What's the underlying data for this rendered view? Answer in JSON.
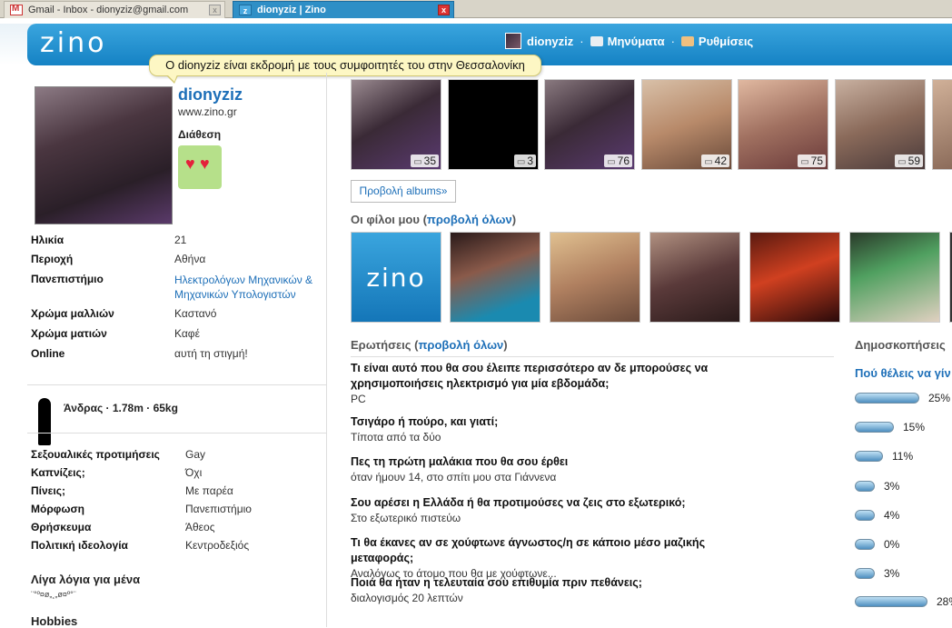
{
  "browser": {
    "tabs": [
      {
        "label": "Gmail - Inbox - dionyziz@gmail.com",
        "active": false,
        "icon": "gmail-icon"
      },
      {
        "label": "dionyziz | Zino",
        "active": true,
        "icon": "zino-icon"
      }
    ]
  },
  "header": {
    "logo": "zino",
    "user": "dionyziz",
    "messages": "Μηνύματα",
    "settings": "Ρυθμίσεις",
    "separator": "·"
  },
  "tooltip": "Ο dionyziz είναι εκδρομή με τους συμφοιτητές του στην Θεσσαλονίκη",
  "profile": {
    "name": "dionyziz",
    "site": "www.zino.gr",
    "mood_label": "Διάθεση",
    "details": [
      {
        "key": "Ηλικία",
        "value": "21"
      },
      {
        "key": "Περιοχή",
        "value": "Αθήνα"
      },
      {
        "key": "Πανεπιστήμιο",
        "value": "Ηλεκτρολόγων Μηχανικών & Μηχανικών Υπολογιστών"
      },
      {
        "key": "Χρώμα μαλλιών",
        "value": "Καστανό"
      },
      {
        "key": "Χρώμα ματιών",
        "value": "Καφέ"
      },
      {
        "key": "Online",
        "value": "αυτή τη στιγμή!"
      }
    ],
    "body": "Άνδρας · 1.78m · 65kg",
    "prefs": [
      {
        "key": "Σεξουαλικές προτιμήσεις",
        "value": "Gay"
      },
      {
        "key": "Καπνίζεις;",
        "value": "Όχι"
      },
      {
        "key": "Πίνεις;",
        "value": "Με παρέα"
      },
      {
        "key": "Μόρφωση",
        "value": "Πανεπιστήμιο"
      },
      {
        "key": "Θρήσκευμα",
        "value": "Άθεος"
      },
      {
        "key": "Πολιτική ιδεολογία",
        "value": "Κεντροδεξιός"
      }
    ],
    "about_label": "Λίγα λόγια για μένα",
    "about_value": "¨°º¤ø„¸„ø¤º°¨",
    "hobbies_label": "Hobbies"
  },
  "photos": {
    "counts": [
      "35",
      "3",
      "76",
      "42",
      "75",
      "59"
    ],
    "albums_button": "Προβολή albums»"
  },
  "friends": {
    "title": "Οι φίλοι μου",
    "view_all": "προβολή όλων",
    "zino_label": "zino"
  },
  "questions": {
    "title": "Ερωτήσεις",
    "view_all": "προβολή όλων",
    "items": [
      {
        "q": "Τι είναι αυτό που θα σου έλειπε περισσότερο αν δε μπορούσες να χρησιμοποιήσεις ηλεκτρισμό για μία εβδομάδα;",
        "a": "PC"
      },
      {
        "q": "Τσιγάρο ή πούρο, και γιατί;",
        "a": "Τίποτα από τα δύο"
      },
      {
        "q": "Πες τη πρώτη μαλάκια που θα σου έρθει",
        "a": "όταν ήμουν 14, στο σπίτι μου στα Γιάννενα"
      },
      {
        "q": "Σου αρέσει η Ελλάδα ή θα προτιμούσες να ζεις στο εξωτερικό;",
        "a": "Στο εξωτερικό πιστεύω"
      },
      {
        "q": "Τι θα έκανες αν σε χούφτωνε άγνωστος/η σε κάποιο μέσο μαζικής μεταφοράς;",
        "a": "Αναλόγως το άτομο που θα με χούφτωνε..."
      },
      {
        "q": "Ποιά θα ήταν η τελευταία σου επιθυμία πριν πεθάνεις;",
        "a": "διαλογισμός 20 λεπτών"
      }
    ]
  },
  "poll": {
    "title": "Δημοσκοπήσεις",
    "question": "Πού θέλεις να γίν",
    "results": [
      "25%",
      "15%",
      "11%",
      "3%",
      "4%",
      "0%",
      "3%",
      "28%"
    ],
    "fractions": [
      0.25,
      0.15,
      0.11,
      0.03,
      0.04,
      0.0,
      0.03,
      0.28
    ]
  }
}
